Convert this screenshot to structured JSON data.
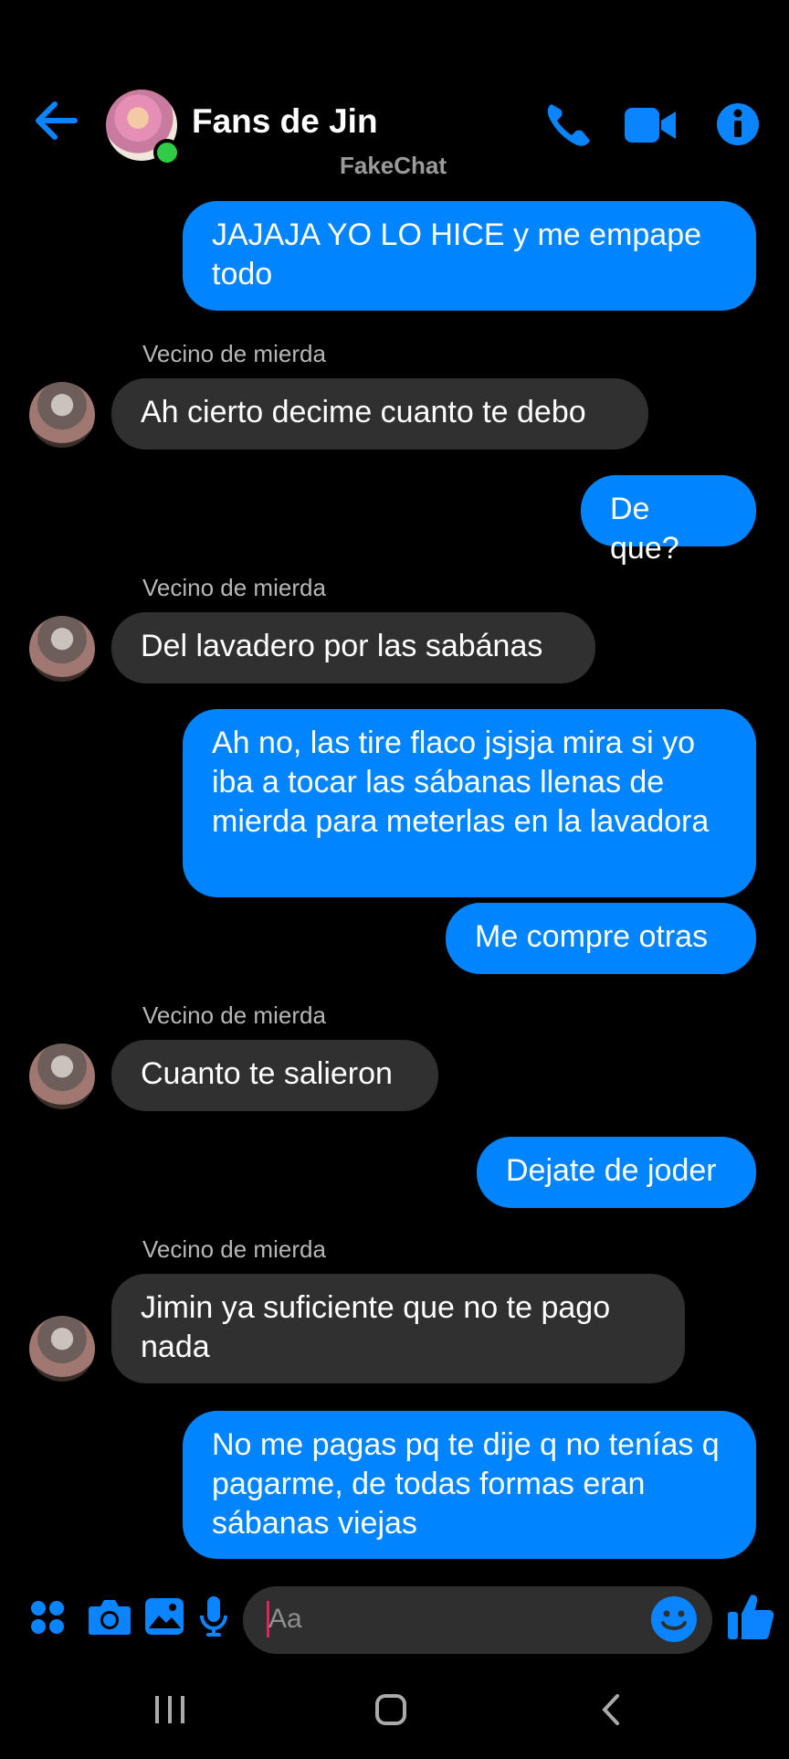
{
  "header": {
    "title": "Fans de Jin",
    "subtitle": "FakeChat",
    "back_icon": "arrow-left-icon",
    "call_icon": "phone-icon",
    "video_icon": "video-camera-icon",
    "info_icon": "info-icon"
  },
  "messages": [
    {
      "from": "me",
      "text": "JAJAJA YO LO HICE y me empape todo"
    },
    {
      "from": "them",
      "sender": "Vecino de mierda",
      "text": "Ah cierto decime cuanto te debo"
    },
    {
      "from": "me",
      "text": "De que?"
    },
    {
      "from": "them",
      "sender": "Vecino de mierda",
      "text": "Del lavadero por las sabánas"
    },
    {
      "from": "me",
      "text": "Ah no, las tire flaco jsjsja mira si yo iba a tocar las sábanas llenas de mierda para meterlas en la lavadora"
    },
    {
      "from": "me",
      "text": "Me compre otras"
    },
    {
      "from": "them",
      "sender": "Vecino de mierda",
      "text": "Cuanto te salieron"
    },
    {
      "from": "me",
      "text": "Dejate de joder"
    },
    {
      "from": "them",
      "sender": "Vecino de mierda",
      "text": "Jimin ya suficiente que no te pago nada"
    },
    {
      "from": "me",
      "text": "No me pagas pq te dije q no tenías q pagarme, de todas formas eran sábanas viejas"
    }
  ],
  "composer": {
    "placeholder": "Aa",
    "menu_icon": "apps-icon",
    "camera_icon": "camera-icon",
    "gallery_icon": "image-icon",
    "mic_icon": "microphone-icon",
    "emoji_icon": "smiley-icon",
    "like_icon": "thumbs-up-icon"
  },
  "colors": {
    "accent": "#0084ff",
    "incoming": "#303030",
    "background": "#000000"
  }
}
